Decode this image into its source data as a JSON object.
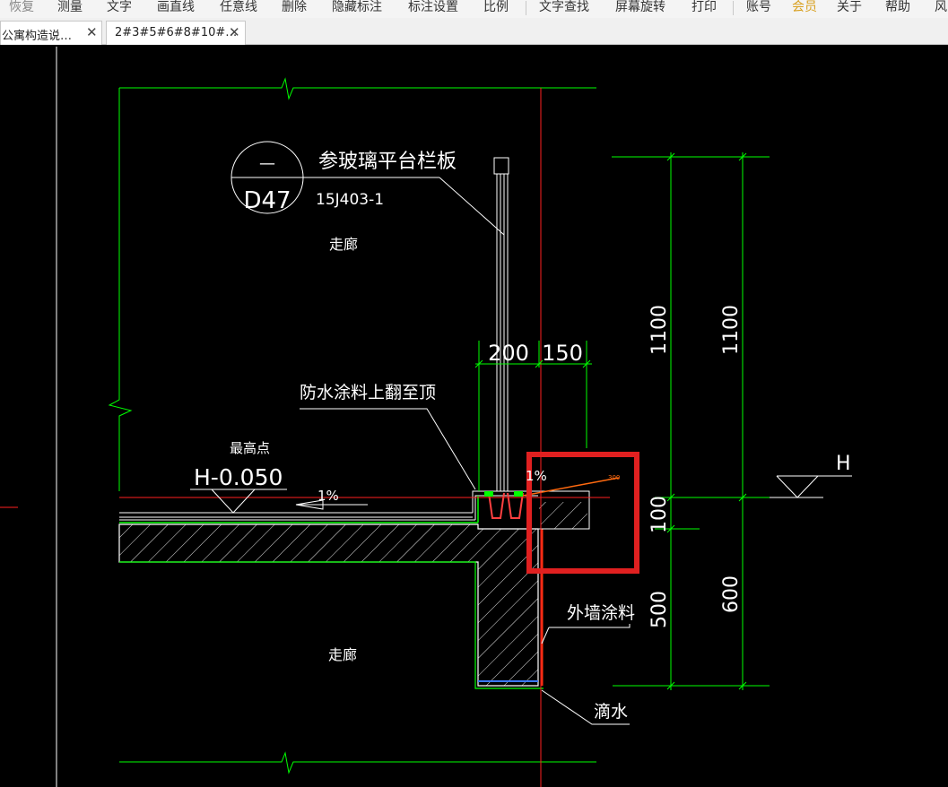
{
  "menu": {
    "restore": "恢复",
    "measure": "测量",
    "text": "文字",
    "draw_line": "画直线",
    "free_line": "任意线",
    "delete": "删除",
    "hide_dims": "隐藏标注",
    "dim_settings": "标注设置",
    "scale": "比例",
    "text_search": "文字查找",
    "screen_rotate": "屏幕旋转",
    "print": "打印",
    "account": "账号",
    "member": "会员",
    "about": "关于",
    "help": "帮助",
    "style": "风"
  },
  "tabs": [
    {
      "label": "公寓构造说…",
      "close": "✕"
    },
    {
      "label": "2#3#5#6#8#10#…",
      "close": "✕"
    }
  ],
  "drawing": {
    "detail_top": "—",
    "detail_id": "D47",
    "railing_label": "参玻璃平台栏板",
    "std_ref": "15J403-1",
    "corridor_upper": "走廊",
    "corridor_lower": "走廊",
    "waterproof_note": "防水涂料上翻至顶",
    "highest_point": "最高点",
    "elevation": "H-0.050",
    "slope_main": "1%",
    "slope_curb": "1%",
    "small_dim": "300",
    "level_h": "H",
    "ext_paint": "外墙涂料",
    "drip": "滴水",
    "dims": {
      "d200": "200",
      "d150": "150",
      "d1100a": "1100",
      "d1100b": "1100",
      "d100": "100",
      "d500": "500",
      "d600": "600"
    }
  },
  "colors": {
    "background": "#000000",
    "line_green": "#00ff00",
    "line_white": "#ffffff",
    "line_red": "#ff2020",
    "highlight_box": "#e02020",
    "menu_bg": "#f4f4f4",
    "member_text": "#d8a020"
  }
}
